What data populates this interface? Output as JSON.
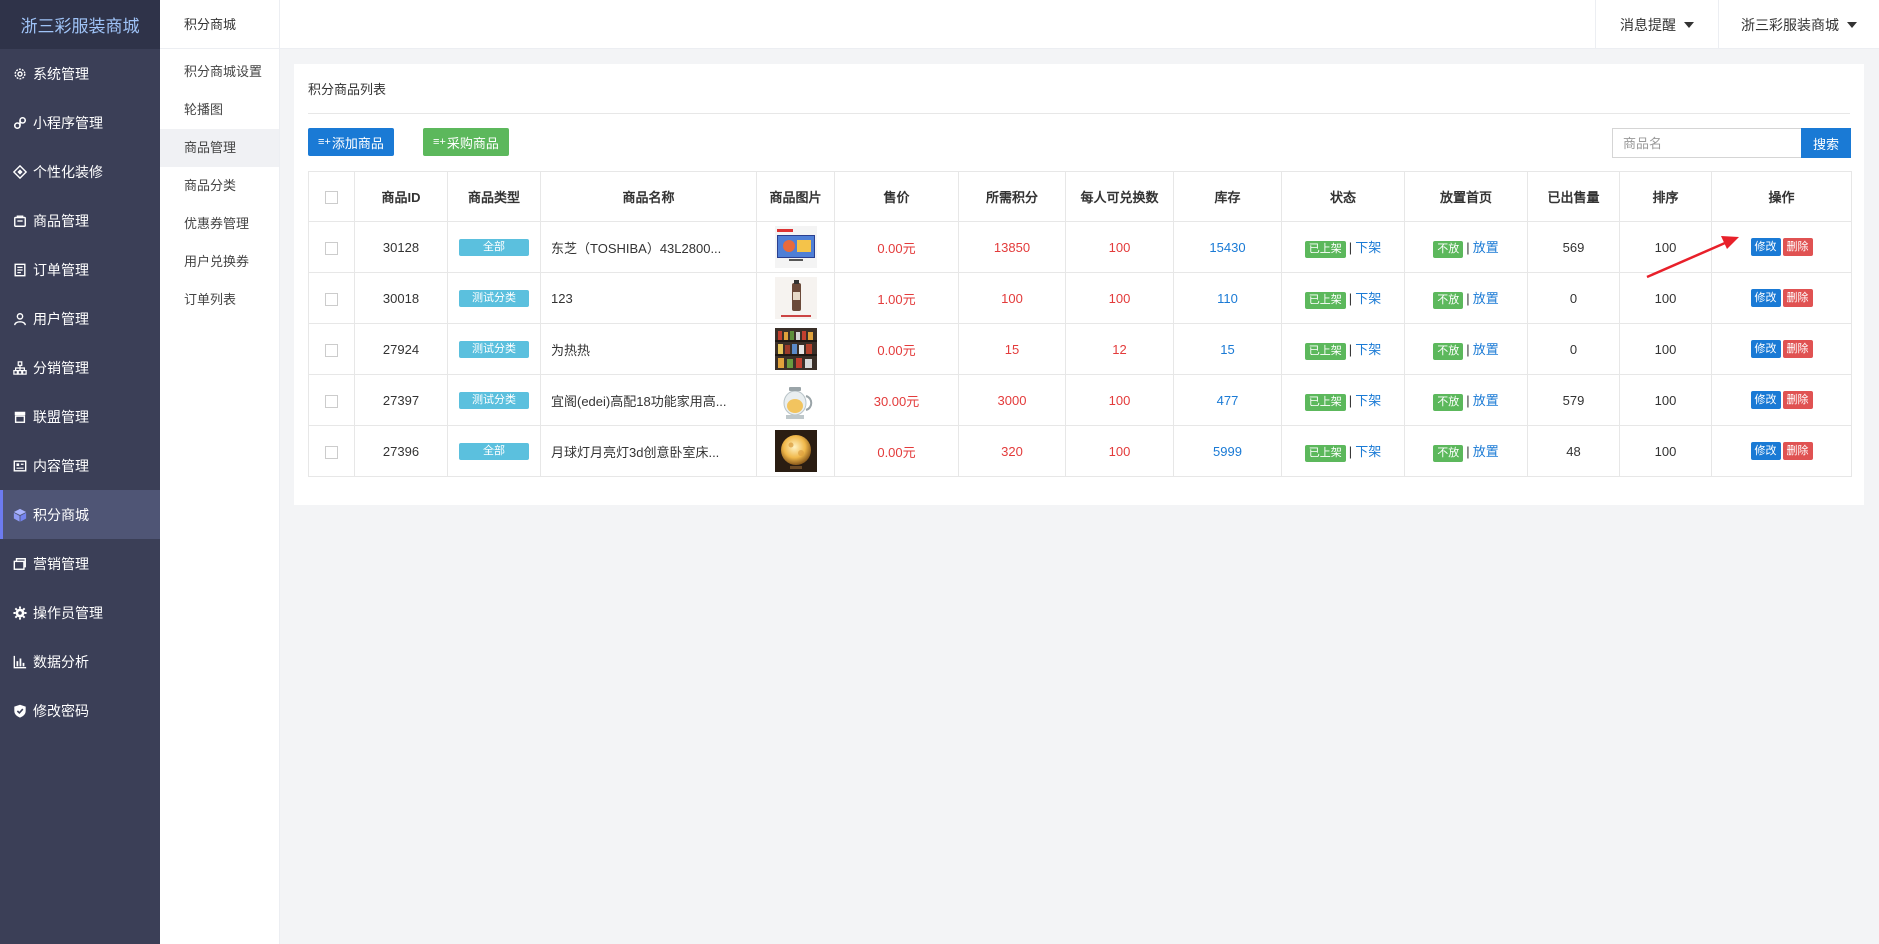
{
  "brand": "浙三彩服装商城",
  "nav": [
    {
      "label": "系统管理",
      "icon": "gear-outline-icon"
    },
    {
      "label": "小程序管理",
      "icon": "miniprogram-icon"
    },
    {
      "label": "个性化装修",
      "icon": "diamond-icon"
    },
    {
      "label": "商品管理",
      "icon": "bag-icon"
    },
    {
      "label": "订单管理",
      "icon": "document-icon"
    },
    {
      "label": "用户管理",
      "icon": "user-icon"
    },
    {
      "label": "分销管理",
      "icon": "sitemap-icon"
    },
    {
      "label": "联盟管理",
      "icon": "store-icon"
    },
    {
      "label": "内容管理",
      "icon": "content-icon"
    },
    {
      "label": "积分商城",
      "icon": "cube-icon",
      "active": true
    },
    {
      "label": "营销管理",
      "icon": "marketing-icon"
    },
    {
      "label": "操作员管理",
      "icon": "gear-icon"
    },
    {
      "label": "数据分析",
      "icon": "bar-chart-icon"
    },
    {
      "label": "修改密码",
      "icon": "shield-check-icon"
    }
  ],
  "submenu": {
    "title": "积分商城",
    "items": [
      "积分商城设置",
      "轮播图",
      "商品管理",
      "商品分类",
      "优惠券管理",
      "用户兑换券",
      "订单列表"
    ],
    "active_index": 2
  },
  "header": {
    "notifications": "消息提醒",
    "store": "浙三彩服装商城"
  },
  "panel": {
    "title": "积分商品列表",
    "add_button": "添加商品",
    "purchase_button": "采购商品",
    "search_placeholder": "商品名",
    "search_button": "搜索"
  },
  "table": {
    "headers": [
      "商品ID",
      "商品类型",
      "商品名称",
      "商品图片",
      "售价",
      "所需积分",
      "每人可兑换数",
      "库存",
      "状态",
      "放置首页",
      "已出售量",
      "排序",
      "操作"
    ],
    "rows": [
      {
        "id": "30128",
        "type": "全部",
        "name": "东芝（TOSHIBA）43L2800...",
        "image": "tv",
        "price": "0.00元",
        "points": "13850",
        "limit": "100",
        "stock": "15430",
        "status": "已上架",
        "status_action": "下架",
        "home": "不放",
        "home_action": "放置",
        "sold": "569",
        "sort": "100"
      },
      {
        "id": "30018",
        "type": "测试分类",
        "name": "123",
        "image": "bottle",
        "price": "1.00元",
        "points": "100",
        "limit": "100",
        "stock": "110",
        "status": "已上架",
        "status_action": "下架",
        "home": "不放",
        "home_action": "放置",
        "sold": "0",
        "sort": "100"
      },
      {
        "id": "27924",
        "type": "测试分类",
        "name": "为热热",
        "image": "shelf",
        "price": "0.00元",
        "points": "15",
        "limit": "12",
        "stock": "15",
        "status": "已上架",
        "status_action": "下架",
        "home": "不放",
        "home_action": "放置",
        "sold": "0",
        "sort": "100"
      },
      {
        "id": "27397",
        "type": "测试分类",
        "name": "宜阁(edei)高配18功能家用高...",
        "image": "kettle",
        "price": "30.00元",
        "points": "3000",
        "limit": "100",
        "stock": "477",
        "status": "已上架",
        "status_action": "下架",
        "home": "不放",
        "home_action": "放置",
        "sold": "579",
        "sort": "100"
      },
      {
        "id": "27396",
        "type": "全部",
        "name": "月球灯月亮灯3d创意卧室床...",
        "image": "moon-lamp",
        "price": "0.00元",
        "points": "320",
        "limit": "100",
        "stock": "5999",
        "status": "已上架",
        "status_action": "下架",
        "home": "不放",
        "home_action": "放置",
        "sold": "48",
        "sort": "100"
      }
    ],
    "edit_label": "修改",
    "delete_label": "删除"
  },
  "colors": {
    "sidebar": "#3b3f57",
    "brand_bg": "#2f3349",
    "primary": "#1a7ad5",
    "success": "#5cb85c",
    "danger": "#e05252",
    "info": "#5bc0de",
    "price_red": "#e33b3b",
    "annotation_arrow": "#e8202a"
  }
}
